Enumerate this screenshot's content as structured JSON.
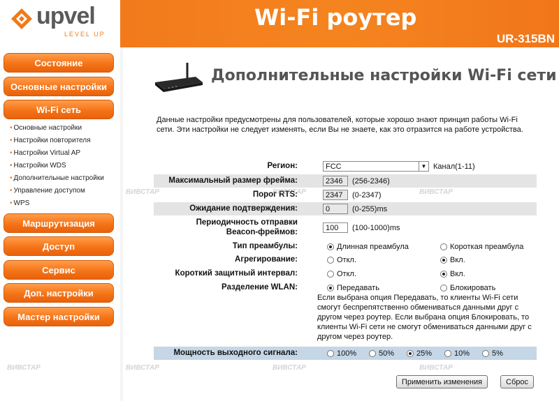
{
  "brand": {
    "name": "upvel",
    "slogan": "LEVEL UP"
  },
  "header": {
    "title": "Wi-Fi роутер",
    "model": "UR-315BN"
  },
  "sidebar": {
    "main_items": [
      {
        "label": "Состояние"
      },
      {
        "label": "Основные настройки"
      },
      {
        "label": "Wi-Fi сеть"
      },
      {
        "label": "Маршрутизация"
      },
      {
        "label": "Доступ"
      },
      {
        "label": "Сервис"
      },
      {
        "label": "Доп. настройки"
      },
      {
        "label": "Мастер настройки"
      }
    ],
    "sub_items": [
      {
        "label": "Основные настройки"
      },
      {
        "label": "Настройки повторителя"
      },
      {
        "label": "Настройки Virtual AP"
      },
      {
        "label": "Настройки WDS"
      },
      {
        "label": "Дополнительные настройки"
      },
      {
        "label": "Управление доступом"
      },
      {
        "label": "WPS"
      }
    ]
  },
  "page": {
    "title": "Дополнительные настройки Wi-Fi сети",
    "description": "Данные настройки предусмотрены для пользователей, которые хорошо знают принцип работы Wi-Fi сети. Эти настройки не следует изменять, если Вы не знаете, как это отразится на работе устройства."
  },
  "form": {
    "region": {
      "label": "Регион:",
      "value": "FCC",
      "note": "Канал(1-11)"
    },
    "frame_size": {
      "label": "Максимальный размер фрейма:",
      "value": "2346",
      "range": "(256-2346)"
    },
    "rts": {
      "label": "Порог RTS:",
      "value": "2347",
      "range": "(0-2347)"
    },
    "ack_timeout": {
      "label": "Ожидание подтверждения:",
      "value": "0",
      "range": "(0-255)ms"
    },
    "beacon": {
      "label_line1": "Периодичность отправки",
      "label_line2": "Beacon-фреймов:",
      "value": "100",
      "range": "(100-1000)ms"
    },
    "preamble": {
      "label": "Тип преамбулы:",
      "opt1": "Длинная преамбула",
      "opt2": "Короткая преамбула"
    },
    "aggregation": {
      "label": "Агрегирование:",
      "opt1": "Откл.",
      "opt2": "Вкл."
    },
    "guard": {
      "label": "Короткий защитный интервал:",
      "opt1": "Откл.",
      "opt2": "Вкл."
    },
    "wlan_sep": {
      "label": "Разделение WLAN:",
      "opt1": "Передавать",
      "opt2": "Блокировать",
      "help": "Если выбрана опция Передавать, то клиенты Wi-Fi сети смогут беспрепятственно обмениваться данными друг с другом через роутер. Если выбрана опция Блокировать, то клиенты Wi-Fi сети не смогут обмениваться данными друг с другом через роутер."
    },
    "power": {
      "label": "Мощность выходного сигнала:",
      "opts": [
        "100%",
        "50%",
        "25%",
        "10%",
        "5%"
      ]
    }
  },
  "buttons": {
    "apply": "Применить изменения",
    "reset": "Сброс"
  },
  "watermark": "ВИВСТАР"
}
